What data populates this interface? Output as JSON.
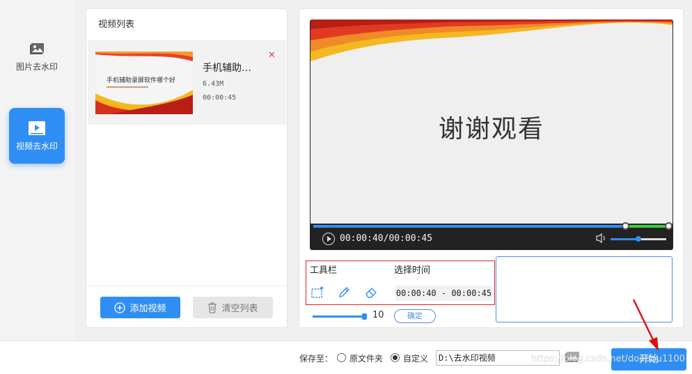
{
  "nav": {
    "items": [
      {
        "label": "图片去水印",
        "icon": "image-icon",
        "active": false
      },
      {
        "label": "视频去水印",
        "icon": "video-play-icon",
        "active": true
      }
    ]
  },
  "video_list": {
    "title": "视频列表",
    "items": [
      {
        "thumb_title": "手机辅助录屏软件哪个好",
        "name": "手机辅助…",
        "size": "6.43M",
        "duration": "00:00:45"
      }
    ],
    "add_button": "添加视频",
    "clear_button": "清空列表"
  },
  "preview": {
    "video_text": "谢谢观看",
    "time_display": "00:00:40/00:00:45",
    "progress_fraction": 0.889,
    "volume_fraction": 0.5
  },
  "tools": {
    "toolbar_label": "工具栏",
    "select_time_label": "选择时间",
    "time_range": "00:00:40 - 00:00:45",
    "icons": [
      "rect-select-icon",
      "pencil-icon",
      "eraser-icon"
    ],
    "size_value": "10",
    "size_fraction": 0.95,
    "confirm_button": "确定"
  },
  "bottom": {
    "save_to_label": "保存至：",
    "option_original": "原文件夹",
    "option_custom": "自定义",
    "selected": "自定义",
    "path": "D:\\去水印视频",
    "start_button": "开始",
    "watermark": "https://blog.csdn.net/doudou1100"
  },
  "colors": {
    "accent": "#2f8ef4",
    "highlight_border": "#e02020",
    "progress_green": "#36d13a"
  }
}
